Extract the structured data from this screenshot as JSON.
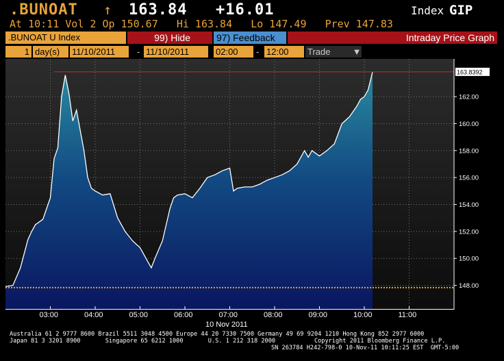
{
  "header": {
    "ticker": ".BUNOAT",
    "arrow": "↑",
    "price": "163.84",
    "change": "+16.01",
    "index_label": "Index",
    "index_name": "GIP",
    "row2": "At 10:11 Vol 2 Op 150.67   Hi 163.84   Lo 147.49   Prev 147.83"
  },
  "toolbar": {
    "security": ".BUNOAT U Index",
    "hide_label": "99) Hide",
    "feedback_label": "97) Feedback",
    "title": "Intraday Price Graph"
  },
  "controls": {
    "period_count": "1",
    "period_unit": "day(s)",
    "start_date": "11/10/2011",
    "dash1": "-",
    "end_date": "11/10/2011",
    "start_time": "02:00",
    "dash2": "-",
    "end_time": "12:00",
    "mode": "Trade",
    "mode_arrow": "▼"
  },
  "chart_data": {
    "type": "area",
    "ylim": [
      146.2,
      164.8
    ],
    "y_ticks": [
      "148.00",
      "150.00",
      "152.00",
      "154.00",
      "156.00",
      "158.00",
      "160.00",
      "162.00"
    ],
    "x_ticks": [
      "03:00",
      "04:00",
      "05:00",
      "06:00",
      "07:00",
      "08:00",
      "09:00",
      "10:00",
      "11:00"
    ],
    "x_date_label": "10 Nov 2011",
    "last_value_label": "163.8392",
    "prev_close": 147.83,
    "series": [
      {
        "x": [
          "02:00",
          "02:10",
          "02:20",
          "02:30",
          "02:35",
          "02:40",
          "02:50",
          "03:00",
          "03:05",
          "03:10",
          "03:15",
          "03:20",
          "03:25",
          "03:30",
          "03:35",
          "03:45",
          "03:50",
          "03:55",
          "04:00",
          "04:10",
          "04:20",
          "04:30",
          "04:40",
          "04:50",
          "05:00",
          "05:10",
          "05:15",
          "05:20",
          "05:30",
          "05:40",
          "05:45",
          "05:50",
          "06:00",
          "06:10",
          "06:20",
          "06:30",
          "06:40",
          "06:50",
          "07:00",
          "07:05",
          "07:10",
          "07:20",
          "07:30",
          "07:40",
          "07:50",
          "08:00",
          "08:10",
          "08:20",
          "08:30",
          "08:40",
          "08:45",
          "08:50",
          "09:00",
          "09:10",
          "09:20",
          "09:30",
          "09:40",
          "09:50",
          "09:55",
          "10:00",
          "10:05",
          "10:10",
          "10:11"
        ],
        "y": [
          147.9,
          148.0,
          149.3,
          151.4,
          152.0,
          152.5,
          152.9,
          154.5,
          157.4,
          158.2,
          162.0,
          163.6,
          162.2,
          160.2,
          161.0,
          158.0,
          156.0,
          155.2,
          155.0,
          154.7,
          154.8,
          153.0,
          152.0,
          151.3,
          150.8,
          149.8,
          149.3,
          150.0,
          151.3,
          153.7,
          154.5,
          154.7,
          154.8,
          154.5,
          155.2,
          156.0,
          156.2,
          156.5,
          156.7,
          155.0,
          155.2,
          155.3,
          155.3,
          155.5,
          155.8,
          156.0,
          156.2,
          156.5,
          157.0,
          158.0,
          157.5,
          158.0,
          157.6,
          158.0,
          158.5,
          160.0,
          160.5,
          161.3,
          161.8,
          162.0,
          162.5,
          163.6,
          163.84
        ]
      }
    ]
  },
  "footer": {
    "line1": "Australia 61 2 9777 8600 Brazil 5511 3048 4500 Europe 44 20 7330 7500 Germany 49 69 9204 1210 Hong Kong 852 2977 6000",
    "line2": "Japan 81 3 3201 8900       Singapore 65 6212 1000       U.S. 1 212 318 2000           Copyright 2011 Bloomberg Finance L.P.",
    "line3": "SN 263784 H242-798-0 10-Nov-11 10:11:25 EST  GMT-5:00"
  },
  "colors": {
    "accent": "#e8a33a",
    "red_bar": "#a51218",
    "blue_button": "#4b8fd0",
    "area_top": "#2a8aa0",
    "area_bottom": "#0a1660"
  }
}
